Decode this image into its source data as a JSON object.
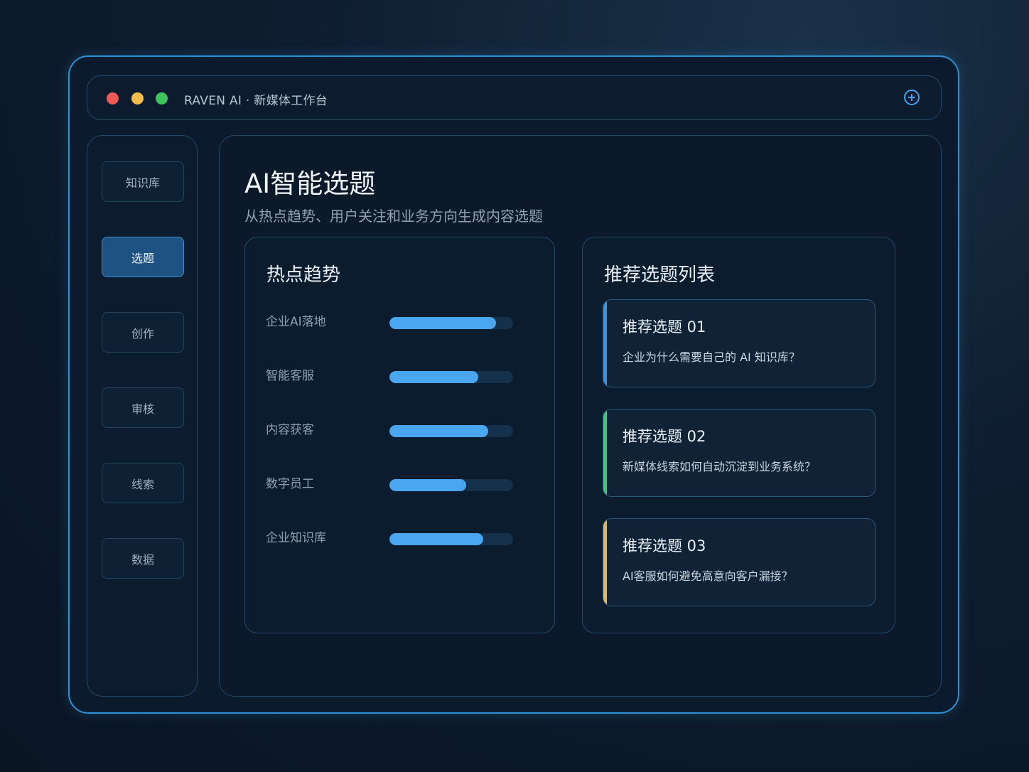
{
  "window": {
    "title": "RAVEN AI · 新媒体工作台"
  },
  "sidebar": {
    "items": [
      {
        "label": "知识库",
        "active": false
      },
      {
        "label": "选题",
        "active": true
      },
      {
        "label": "创作",
        "active": false
      },
      {
        "label": "审核",
        "active": false
      },
      {
        "label": "线索",
        "active": false
      },
      {
        "label": "数据",
        "active": false
      }
    ]
  },
  "main": {
    "title": "AI智能选题",
    "subtitle": "从热点趋势、用户关注和业务方向生成内容选题"
  },
  "trends": {
    "title": "热点趋势",
    "items": [
      {
        "label": "企业AI落地",
        "level": 0.86
      },
      {
        "label": "智能客服",
        "level": 0.72
      },
      {
        "label": "内容获客",
        "level": 0.8
      },
      {
        "label": "数字员工",
        "level": 0.62
      },
      {
        "label": "企业知识库",
        "level": 0.76
      }
    ]
  },
  "recommendations": {
    "title": "推荐选题列表",
    "items": [
      {
        "title": "推荐选题 01",
        "desc": "企业为什么需要自己的 AI 知识库？",
        "accent": "#3b93e0"
      },
      {
        "title": "推荐选题 02",
        "desc": "新媒体线索如何自动沉淀到业务系统？",
        "accent": "#3cc97a"
      },
      {
        "title": "推荐选题 03",
        "desc": "AI客服如何避免高意向客户漏接？",
        "accent": "#e9b84a"
      }
    ]
  },
  "colors": {
    "accent": "#4aa6ee",
    "border_glow": "#2f8fd3"
  }
}
